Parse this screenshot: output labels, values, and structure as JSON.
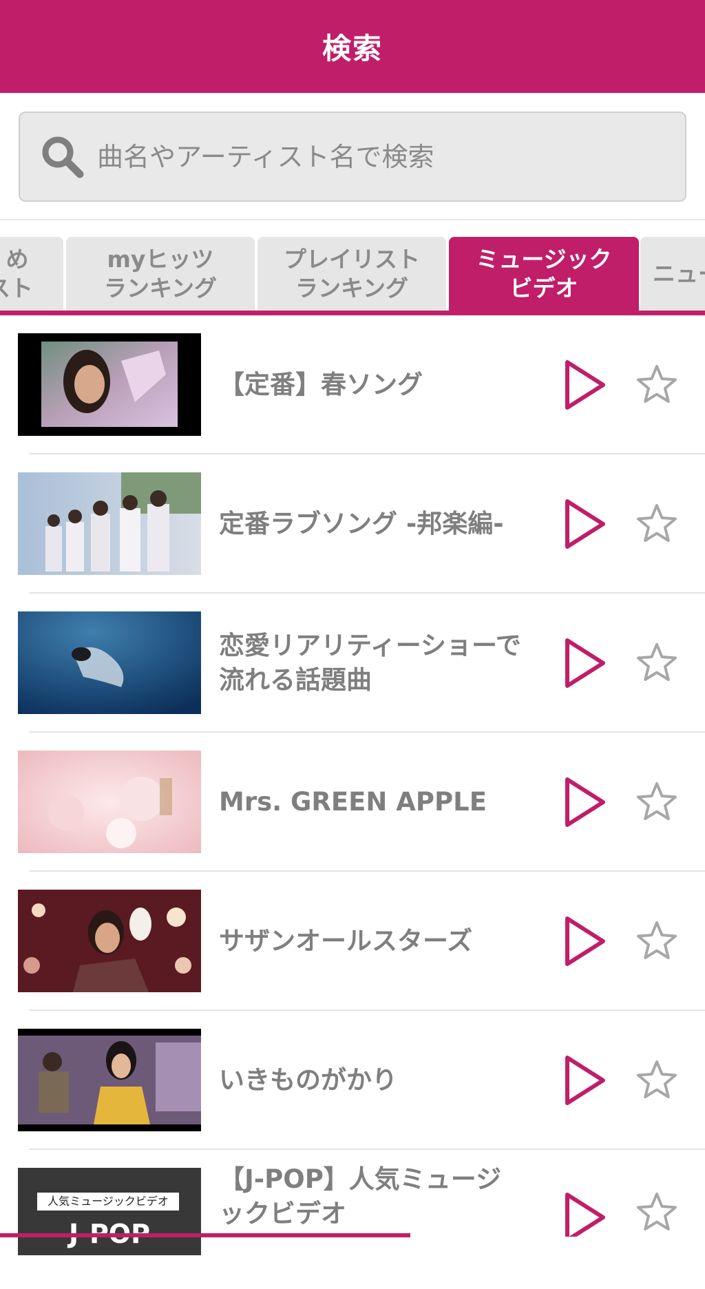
{
  "header": {
    "title": "検索"
  },
  "search": {
    "placeholder": "曲名やアーティスト名で検索"
  },
  "colors": {
    "accent": "#c01e68",
    "tab_inactive": "#e6e6e6",
    "text_gray": "#7f7f7f"
  },
  "tabs": [
    {
      "line1": "め",
      "line2": "スト",
      "active": false
    },
    {
      "line1": "myヒッツ",
      "line2": "ランキング",
      "active": false
    },
    {
      "line1": "プレイリスト",
      "line2": "ランキング",
      "active": false
    },
    {
      "line1": "ミュージック",
      "line2": "ビデオ",
      "active": true
    },
    {
      "line1": "ニュー",
      "line2": "",
      "active": false
    }
  ],
  "items": [
    {
      "title": "【定番】春ソング",
      "thumb_icon": "music-video-thumbnail"
    },
    {
      "title": "定番ラブソング -邦楽編-",
      "thumb_icon": "music-video-thumbnail"
    },
    {
      "title": "恋愛リアリティーショーで流れる話題曲",
      "thumb_icon": "music-video-thumbnail"
    },
    {
      "title": "Mrs. GREEN APPLE",
      "thumb_icon": "music-video-thumbnail"
    },
    {
      "title": "サザンオールスターズ",
      "thumb_icon": "music-video-thumbnail"
    },
    {
      "title": "いきものがかり",
      "thumb_icon": "music-video-thumbnail"
    },
    {
      "title": "【J-POP】人気ミュージックビデオ",
      "thumb_icon": "music-video-thumbnail",
      "thumb_caption": "人気ミュージックビデオ",
      "thumb_label": "J-POP"
    }
  ]
}
